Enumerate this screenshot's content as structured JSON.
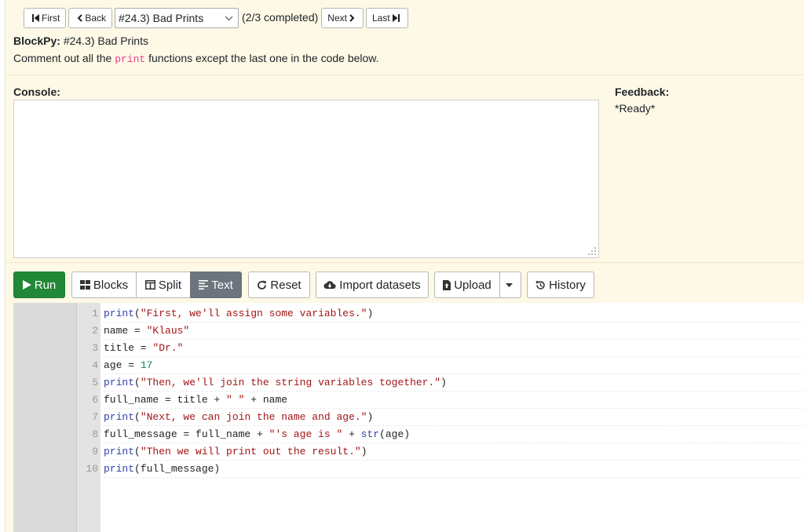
{
  "nav": {
    "first_label": "First",
    "back_label": "Back",
    "assignment_select": "#24.3) Bad Prints",
    "progress_text": "(2/3 completed)",
    "next_label": "Next",
    "last_label": "Last"
  },
  "header": {
    "brand": "BlockPy:",
    "assignment_title": "#24.3) Bad Prints",
    "instructions_before": "Comment out all the",
    "instructions_code": "print",
    "instructions_after": "functions except the last one in the code below."
  },
  "console": {
    "label": "Console:"
  },
  "feedback": {
    "label": "Feedback:",
    "status": "*Ready*"
  },
  "toolbar": {
    "run_label": "Run",
    "blocks_label": "Blocks",
    "split_label": "Split",
    "text_label": "Text",
    "reset_label": "Reset",
    "import_label": "Import datasets",
    "upload_label": "Upload",
    "history_label": "History",
    "active_mode": "Text"
  },
  "editor": {
    "lines": [
      {
        "n": "1",
        "tokens": [
          [
            "kw",
            "print"
          ],
          [
            "p",
            "("
          ],
          [
            "str",
            "\"First, we'll assign some variables.\""
          ],
          [
            "p",
            ")"
          ]
        ]
      },
      {
        "n": "2",
        "tokens": [
          [
            "p",
            "name = "
          ],
          [
            "str",
            "\"Klaus\""
          ]
        ]
      },
      {
        "n": "3",
        "tokens": [
          [
            "p",
            "title = "
          ],
          [
            "str",
            "\"Dr.\""
          ]
        ]
      },
      {
        "n": "4",
        "tokens": [
          [
            "p",
            "age = "
          ],
          [
            "num",
            "17"
          ]
        ]
      },
      {
        "n": "5",
        "tokens": [
          [
            "kw",
            "print"
          ],
          [
            "p",
            "("
          ],
          [
            "str",
            "\"Then, we'll join the string variables together.\""
          ],
          [
            "p",
            ")"
          ]
        ]
      },
      {
        "n": "6",
        "tokens": [
          [
            "p",
            "full_name = title + "
          ],
          [
            "str",
            "\" \""
          ],
          [
            "p",
            " + name"
          ]
        ]
      },
      {
        "n": "7",
        "tokens": [
          [
            "kw",
            "print"
          ],
          [
            "p",
            "("
          ],
          [
            "str",
            "\"Next, we can join the name and age.\""
          ],
          [
            "p",
            ")"
          ]
        ]
      },
      {
        "n": "8",
        "tokens": [
          [
            "p",
            "full_message = full_name + "
          ],
          [
            "str",
            "\"'s age is \""
          ],
          [
            "p",
            " + "
          ],
          [
            "kw",
            "str"
          ],
          [
            "p",
            "(age)"
          ]
        ]
      },
      {
        "n": "9",
        "tokens": [
          [
            "kw",
            "print"
          ],
          [
            "p",
            "("
          ],
          [
            "str",
            "\"Then we will print out the result.\""
          ],
          [
            "p",
            ")"
          ]
        ]
      },
      {
        "n": "10",
        "tokens": [
          [
            "kw",
            "print"
          ],
          [
            "p",
            "(full_message)"
          ]
        ]
      }
    ]
  },
  "colors": {
    "background": "#fdf9e6",
    "run_green": "#218838",
    "active_mode": "#6c757d",
    "keyword": "#3041a8",
    "string": "#a31515",
    "number": "#098658"
  }
}
